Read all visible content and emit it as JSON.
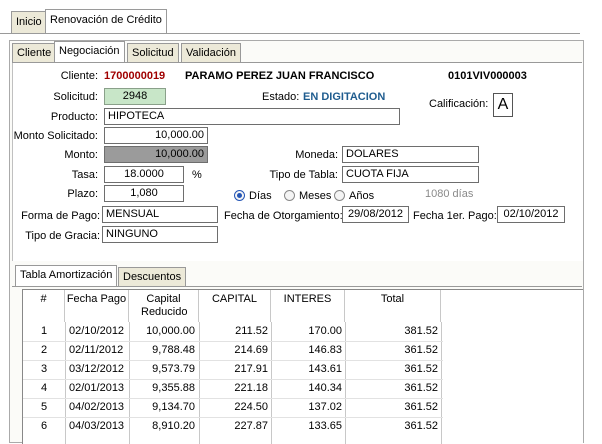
{
  "tabs": {
    "top": [
      "Inicio",
      "Renovación de Crédito"
    ],
    "sub": [
      "Cliente",
      "Negociación",
      "Solicitud",
      "Validación"
    ],
    "bottom": [
      "Tabla Amortización",
      "Descuentos"
    ]
  },
  "form": {
    "cliente_label": "Cliente:",
    "cliente_id": "1700000019",
    "cliente_name": "PARAMO PEREZ JUAN FRANCISCO",
    "cliente_code": "0101VIV000003",
    "solicitud_label": "Solicitud:",
    "solicitud_value": "2948",
    "estado_label": "Estado:",
    "estado_value": "EN DIGITACION",
    "calificacion_label": "Calificación:",
    "calificacion_value": "A",
    "producto_label": "Producto:",
    "producto_value": "HIPOTECA",
    "monto_solicitado_label": "Monto Solicitado:",
    "monto_solicitado_value": "10,000.00",
    "monto_label": "Monto:",
    "monto_value": "10,000.00",
    "moneda_label": "Moneda:",
    "moneda_value": "DOLARES",
    "tasa_label": "Tasa:",
    "tasa_value": "18.0000",
    "tasa_unit": "%",
    "tipo_tabla_label": "Tipo de Tabla:",
    "tipo_tabla_value": "CUOTA FIJA",
    "plazo_label": "Plazo:",
    "plazo_value": "1,080",
    "plazo_options": [
      "Días",
      "Meses",
      "Años"
    ],
    "plazo_selected": "Días",
    "plazo_days_text": "1080 días",
    "forma_pago_label": "Forma de Pago:",
    "forma_pago_value": "MENSUAL",
    "fecha_otorg_label": "Fecha de Otorgamiento:",
    "fecha_otorg_value": "29/08/2012",
    "fecha_1er_label": "Fecha 1er. Pago:",
    "fecha_1er_value": "02/10/2012",
    "tipo_gracia_label": "Tipo de Gracia:",
    "tipo_gracia_value": "NINGUNO"
  },
  "table": {
    "columns": [
      "#",
      "Fecha Pago",
      "Capital Reducido",
      "CAPITAL",
      "INTERES",
      "Total"
    ],
    "rows": [
      [
        "1",
        "02/10/2012",
        "10,000.00",
        "211.52",
        "170.00",
        "381.52"
      ],
      [
        "2",
        "02/11/2012",
        "9,788.48",
        "214.69",
        "146.83",
        "361.52"
      ],
      [
        "3",
        "03/12/2012",
        "9,573.79",
        "217.91",
        "143.61",
        "361.52"
      ],
      [
        "4",
        "02/01/2013",
        "9,355.88",
        "221.18",
        "140.34",
        "361.52"
      ],
      [
        "5",
        "04/02/2013",
        "9,134.70",
        "224.50",
        "137.02",
        "361.52"
      ],
      [
        "6",
        "04/03/2013",
        "8,910.20",
        "227.87",
        "133.65",
        "361.52"
      ]
    ]
  }
}
